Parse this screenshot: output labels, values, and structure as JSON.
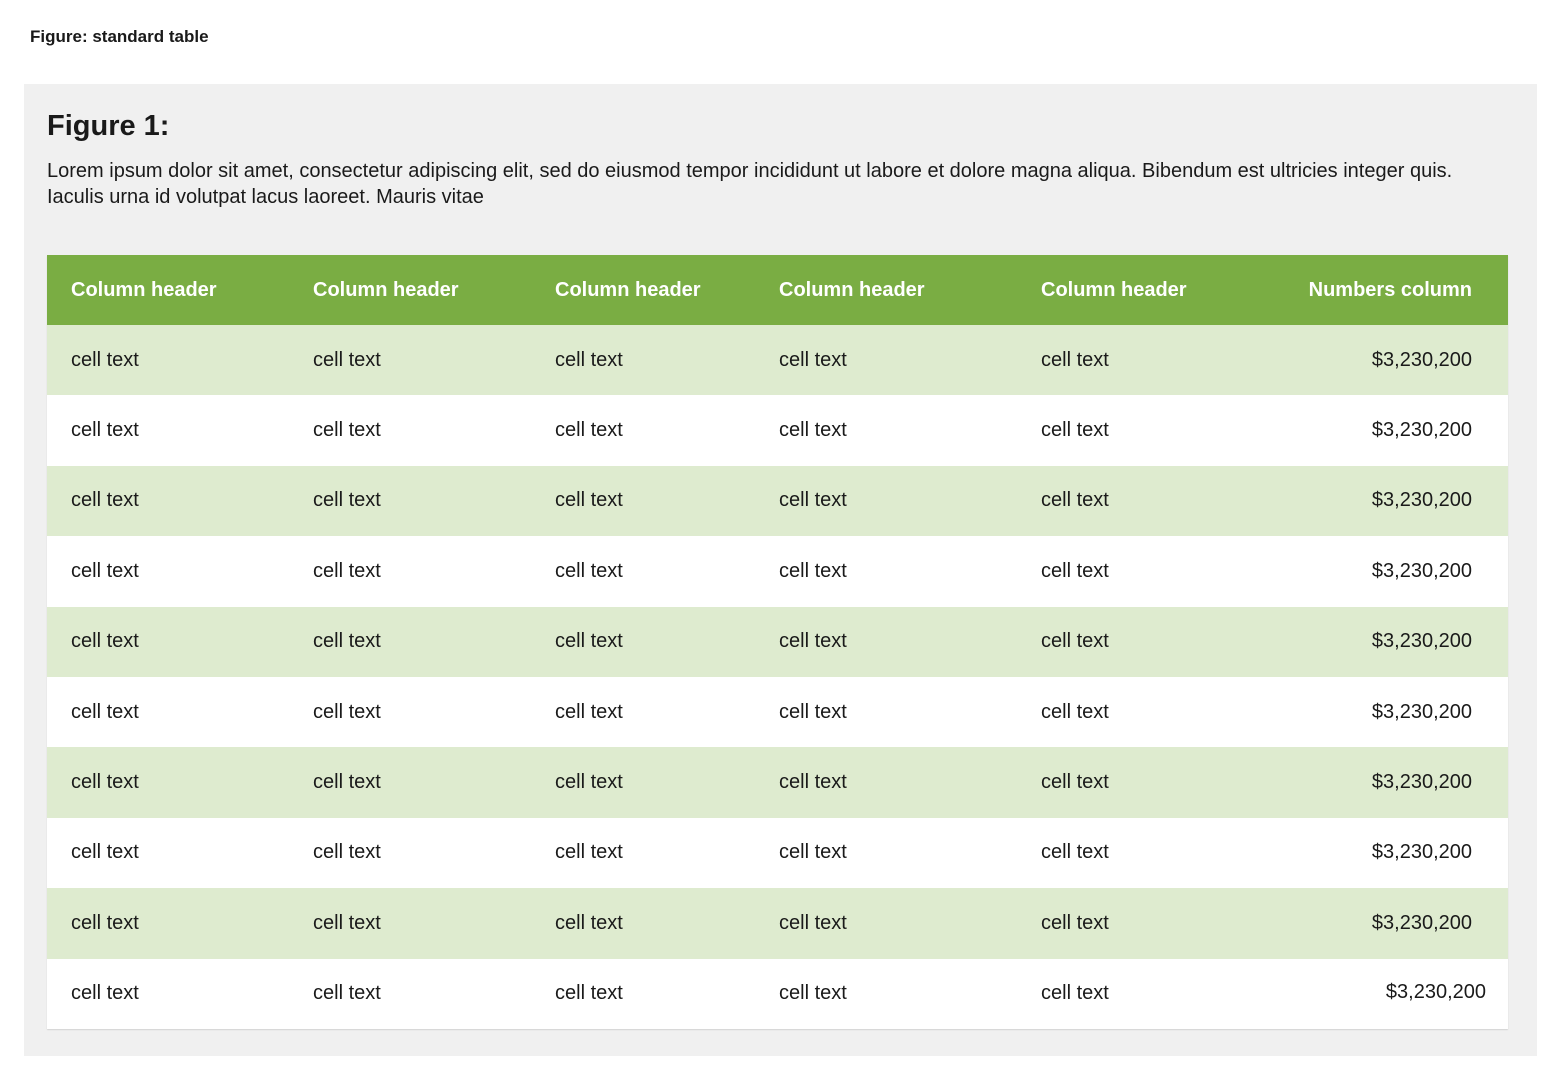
{
  "page": {
    "label": "Figure: standard table"
  },
  "figure": {
    "title": "Figure 1:",
    "description": "Lorem ipsum dolor sit amet, consectetur adipiscing elit, sed do eiusmod tempor incididunt ut labore et dolore magna aliqua. Bibendum est ultricies integer quis. Iaculis urna id volutpat lacus laoreet. Mauris vitae"
  },
  "colors": {
    "header_bg": "#7aad43",
    "row_alt_bg": "#deebcf",
    "panel_bg": "#f0f0f0"
  },
  "table": {
    "headers": [
      "Column header",
      "Column header",
      "Column header",
      "Column header",
      "Column header",
      "Numbers column"
    ],
    "rows": [
      [
        "cell text",
        "cell text",
        "cell text",
        "cell text",
        "cell text",
        "$3,230,200"
      ],
      [
        "cell text",
        "cell text",
        "cell text",
        "cell text",
        "cell text",
        "$3,230,200"
      ],
      [
        "cell text",
        "cell text",
        "cell text",
        "cell text",
        "cell text",
        "$3,230,200"
      ],
      [
        "cell text",
        "cell text",
        "cell text",
        "cell text",
        "cell text",
        "$3,230,200"
      ],
      [
        "cell text",
        "cell text",
        "cell text",
        "cell text",
        "cell text",
        "$3,230,200"
      ],
      [
        "cell text",
        "cell text",
        "cell text",
        "cell text",
        "cell text",
        "$3,230,200"
      ],
      [
        "cell text",
        "cell text",
        "cell text",
        "cell text",
        "cell text",
        "$3,230,200"
      ],
      [
        "cell text",
        "cell text",
        "cell text",
        "cell text",
        "cell text",
        "$3,230,200"
      ],
      [
        "cell text",
        "cell text",
        "cell text",
        "cell text",
        "cell text",
        "$3,230,200"
      ],
      [
        "cell text",
        "cell text",
        "cell text",
        "cell text",
        "cell text",
        "$3,230,200"
      ]
    ]
  }
}
